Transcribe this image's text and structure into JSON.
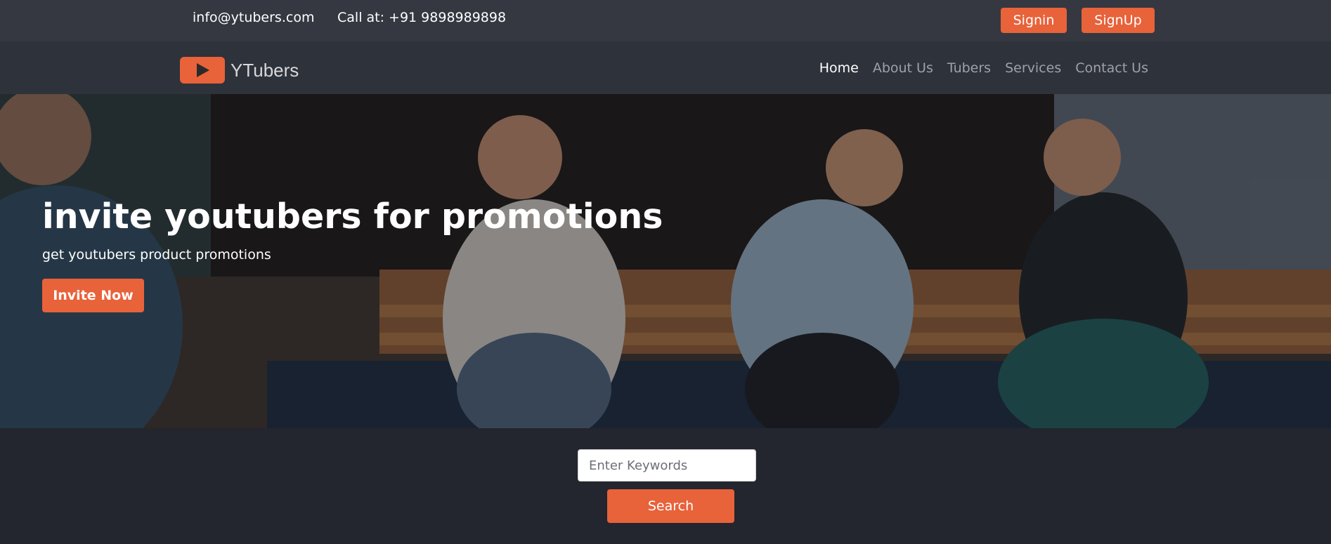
{
  "topbar": {
    "email": "info@ytubers.com",
    "phone": "Call at: +91 9898989898",
    "signin_label": "Signin",
    "signup_label": "SignUp"
  },
  "brand": {
    "name": "YTubers",
    "logo_icon": "play-icon"
  },
  "nav": {
    "items": [
      {
        "label": "Home",
        "active": true
      },
      {
        "label": "About Us",
        "active": false
      },
      {
        "label": "Tubers",
        "active": false
      },
      {
        "label": "Services",
        "active": false
      },
      {
        "label": "Contact Us",
        "active": false
      }
    ]
  },
  "hero": {
    "title": "invite youtubers for promotions",
    "subtitle": "get youtubers product promotions",
    "cta_label": "Invite Now"
  },
  "search": {
    "placeholder": "Enter Keywords",
    "value": "",
    "button_label": "Search"
  },
  "colors": {
    "accent": "#e8623a",
    "topbar_bg": "#353841",
    "navbar_bg": "#2e323b",
    "page_bg": "#23262e"
  }
}
